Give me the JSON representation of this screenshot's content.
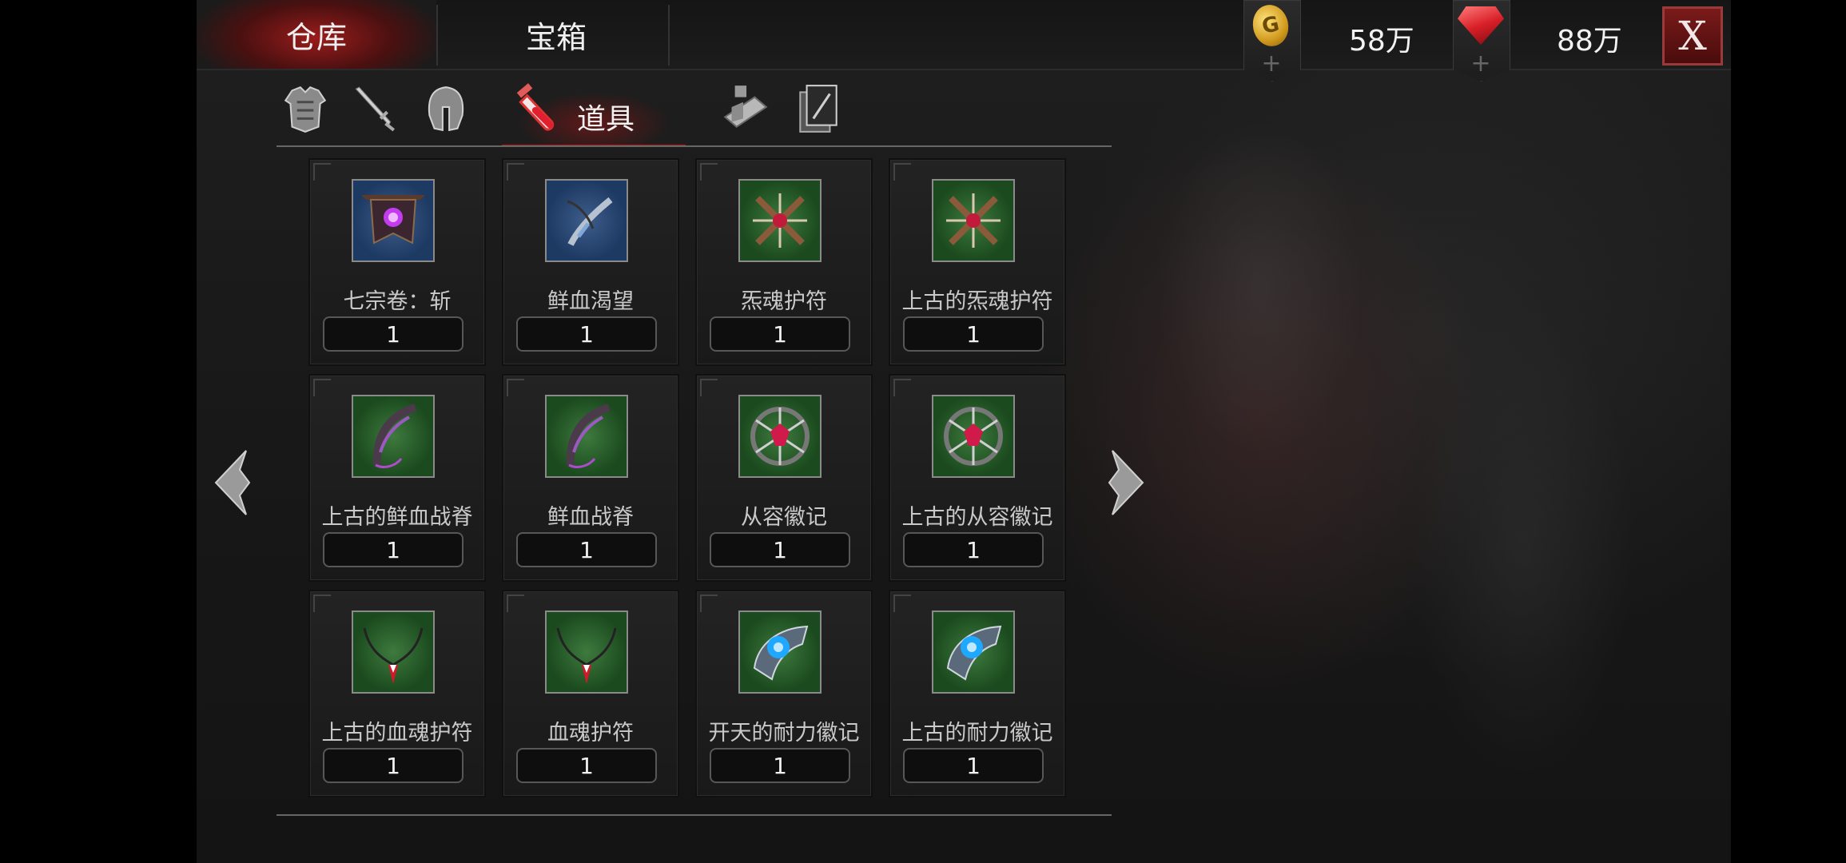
{
  "topbar": {
    "tabs": [
      {
        "label": "仓库",
        "active": true
      },
      {
        "label": "宝箱",
        "active": false
      }
    ],
    "currencies": [
      {
        "icon": "gold-coin-icon",
        "value": "58万"
      },
      {
        "icon": "ruby-gem-icon",
        "value": "88万"
      }
    ],
    "close_label": "X"
  },
  "categories": [
    {
      "icon": "armor-icon",
      "label": ""
    },
    {
      "icon": "sword-icon",
      "label": ""
    },
    {
      "icon": "helmet-icon",
      "label": ""
    },
    {
      "icon": "potion-vial-icon",
      "label": "道具",
      "active": true
    },
    {
      "icon": "scroll-icon",
      "label": ""
    },
    {
      "icon": "card-icon",
      "label": ""
    }
  ],
  "items": [
    {
      "name": "七宗卷：斩",
      "qty": "1",
      "icon": "banner-icon",
      "bg": "blue"
    },
    {
      "name": "鲜血渴望",
      "qty": "1",
      "icon": "blade-icon",
      "bg": "blue"
    },
    {
      "name": "炁魂护符",
      "qty": "1",
      "icon": "cross-amulet-icon",
      "bg": "green"
    },
    {
      "name": "上古的炁魂护符",
      "qty": "1",
      "icon": "cross-amulet-icon",
      "bg": "green"
    },
    {
      "name": "上古的鲜血战脊",
      "qty": "1",
      "icon": "spine-scythe-icon",
      "bg": "green"
    },
    {
      "name": "鲜血战脊",
      "qty": "1",
      "icon": "spine-scythe-icon",
      "bg": "green"
    },
    {
      "name": "从容徽记",
      "qty": "1",
      "icon": "gem-emblem-icon",
      "bg": "green"
    },
    {
      "name": "上古的从容徽记",
      "qty": "1",
      "icon": "gem-emblem-icon",
      "bg": "green"
    },
    {
      "name": "上古的血魂护符",
      "qty": "1",
      "icon": "pendant-icon",
      "bg": "green"
    },
    {
      "name": "血魂护符",
      "qty": "1",
      "icon": "pendant-icon",
      "bg": "green"
    },
    {
      "name": "开天的耐力徽记",
      "qty": "1",
      "icon": "blue-orb-icon",
      "bg": "green"
    },
    {
      "name": "上古的耐力徽记",
      "qty": "1",
      "icon": "blue-orb-icon",
      "bg": "green"
    }
  ],
  "nav": {
    "prev_icon": "left-arrow-icon",
    "next_icon": "right-arrow-icon"
  }
}
